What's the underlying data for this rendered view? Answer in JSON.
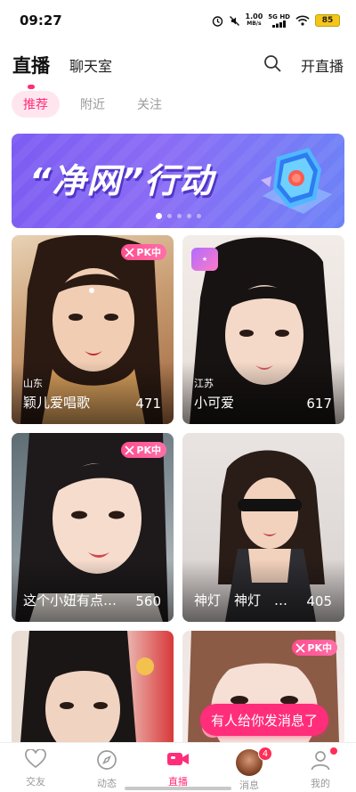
{
  "status_bar": {
    "time": "09:27",
    "net_speed_value": "1.00",
    "net_speed_unit": "MB/s",
    "net_type": "5G HD",
    "battery": "85"
  },
  "header": {
    "tabs": [
      {
        "label": "直播",
        "active": true
      },
      {
        "label": "聊天室",
        "active": false
      }
    ],
    "search_icon": "search-icon",
    "go_live_label": "开直播"
  },
  "sub_tabs": [
    {
      "label": "推荐",
      "active": true
    },
    {
      "label": "附近",
      "active": false
    },
    {
      "label": "关注",
      "active": false
    }
  ],
  "banner": {
    "title": "“净网”行动",
    "page_count": 5,
    "current_page": 1
  },
  "cards": [
    {
      "region": "山东",
      "name": "颖儿爱唱歌",
      "count": "471",
      "badge": "PK中"
    },
    {
      "region": "江苏",
      "name": "小可爱",
      "count": "617",
      "badge": ""
    },
    {
      "region": "",
      "name": "这个小妞有点…",
      "count": "560",
      "badge": "PK中"
    },
    {
      "region": "",
      "name": "神灯　神灯　…",
      "count": "405",
      "badge": ""
    },
    {
      "region": "",
      "name": "",
      "count": "",
      "badge": ""
    },
    {
      "region": "",
      "name": "",
      "count": "",
      "badge": "PK中"
    }
  ],
  "toast": "有人给你发消息了",
  "bottom_nav": [
    {
      "label": "交友",
      "icon": "heart-icon",
      "active": false
    },
    {
      "label": "动态",
      "icon": "compass-icon",
      "active": false
    },
    {
      "label": "直播",
      "icon": "video-camera-icon",
      "active": true
    },
    {
      "label": "消息",
      "icon": "avatar",
      "active": false,
      "badge": "4"
    },
    {
      "label": "我的",
      "icon": "user-icon",
      "active": false,
      "dot": true
    }
  ],
  "colors": {
    "accent": "#ff2d7a",
    "banner": "#7c5cf2"
  }
}
